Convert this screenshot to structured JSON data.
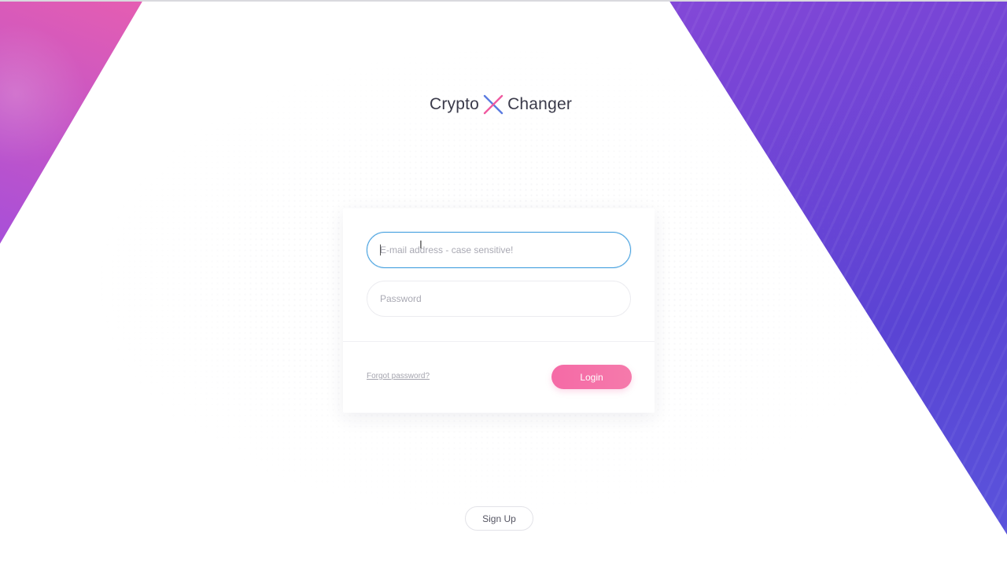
{
  "brand": {
    "word_left": "Crypto",
    "word_right": "Changer",
    "x_icon": "crossed-x-logo",
    "x_colors": [
      "#5b7be0",
      "#f05aa0"
    ]
  },
  "login_form": {
    "email_placeholder": "E-mail address - case sensitive!",
    "email_value": "",
    "password_placeholder": "Password",
    "password_value": "",
    "forgot_label": "Forgot password?",
    "login_label": "Login"
  },
  "footer": {
    "signup_label": "Sign Up"
  },
  "colors": {
    "accent_pink": "#f56aa6",
    "focus_blue": "#4aa3e0",
    "purple": "#7b45d6"
  }
}
